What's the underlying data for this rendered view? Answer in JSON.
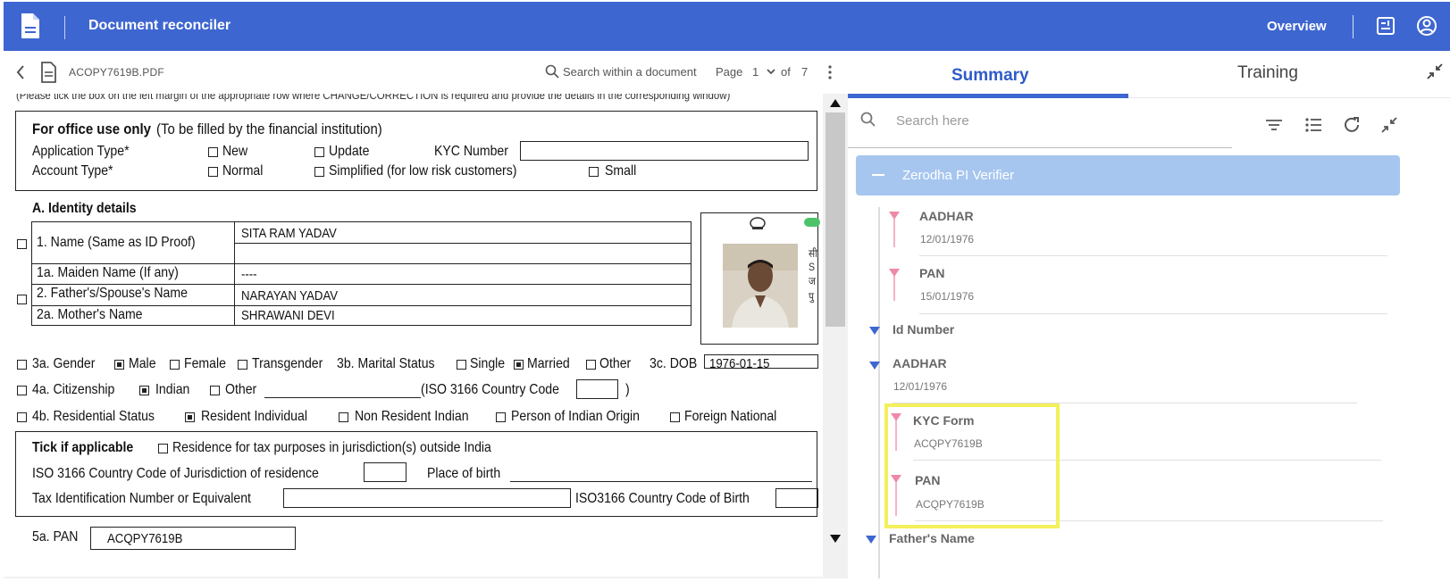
{
  "header": {
    "app_title": "Document reconciler",
    "overview_label": "Overview",
    "icons": [
      "document-icon",
      "report-icon",
      "user-account-icon"
    ]
  },
  "viewer": {
    "file_name": "ACOPY7619B.PDF",
    "search_placeholder": "Search within a document",
    "page_label": "Page",
    "page_current": "1",
    "page_of": "of",
    "page_total": "7",
    "doc": {
      "top_note": "(Please tick the box on the left margin of the appropriate row where CHANGE/CORRECTION is required and provide the details in the corresponding window)",
      "office_heading": "For office use only",
      "office_heading_note": "(To be filled by the financial institution)",
      "application_type": "Application Type*",
      "opt_new": "New",
      "opt_update": "Update",
      "kyc_number": "KYC Number",
      "account_type": "Account Type*",
      "opt_normal": "Normal",
      "opt_simplified": "Simplified (for low risk customers)",
      "opt_small": "Small",
      "identity_heading": "A. Identity details",
      "name_label": "1.   Name (Same as ID Proof)",
      "name_value": "SITA RAM YADAV",
      "maiden_label": "1a. Maiden Name (If any)",
      "maiden_value": "----",
      "father_label": "2.   Father's/Spouse's Name",
      "father_value": "NARAYAN YADAV",
      "mother_label": "2a. Mother's Name",
      "mother_value": "SHRAWANI DEVI",
      "gender_label": "3a. Gender",
      "opt_male": "Male",
      "opt_female": "Female",
      "opt_transgender": "Transgender",
      "marital_label": "3b. Marital Status",
      "opt_single": "Single",
      "opt_married": "Married",
      "opt_other": "Other",
      "dob_label": "3c. DOB",
      "dob_value": "1976-01-15",
      "citizenship_label": "4a. Citizenship",
      "opt_indian": "Indian",
      "opt_other2": "Other",
      "iso_label": "(ISO 3166 Country Code",
      "iso_close": ")",
      "residential_label": "4b. Residential Status",
      "opt_resident": "Resident Individual",
      "opt_nri": "Non Resident Indian",
      "opt_pio": "Person of Indian Origin",
      "opt_foreign": "Foreign National",
      "tick_heading": "Tick if applicable",
      "tick_note": "Residence for tax purposes in jurisdiction(s) outside India",
      "iso_juris": "ISO 3166 Country Code of Jurisdiction of residence",
      "place_birth": "Place of birth",
      "tin_label": "Tax Identification Number or Equivalent",
      "iso_birth": "ISO3166 Country Code of Birth",
      "pan_label": "5a. PAN",
      "pan_value": "ACQPY7619B"
    }
  },
  "panel": {
    "tabs": [
      "Summary",
      "Training"
    ],
    "active_tab": "Summary",
    "search_placeholder": "Search here",
    "group_name": "Zerodha PI Verifier",
    "nodes": [
      {
        "title": "AADHAR",
        "value": "12/01/1976",
        "marker": "pink"
      },
      {
        "title": "PAN",
        "value": "15/01/1976",
        "marker": "pink"
      },
      {
        "title": "Id Number",
        "value": "",
        "marker": "blue"
      },
      {
        "title": "AADHAR",
        "value": "12/01/1976",
        "marker": "blue"
      },
      {
        "title": "KYC Form",
        "value": "ACQPY7619B",
        "marker": "pink"
      },
      {
        "title": "PAN",
        "value": "ACQPY7619B",
        "marker": "pink"
      },
      {
        "title": "Father's Name",
        "value": "",
        "marker": "blue"
      }
    ],
    "colors": {
      "accent": "#3e66d1",
      "group_bg": "#a6c6ef",
      "pink": "#ee8aa6",
      "highlight": "#f4f05c"
    }
  }
}
